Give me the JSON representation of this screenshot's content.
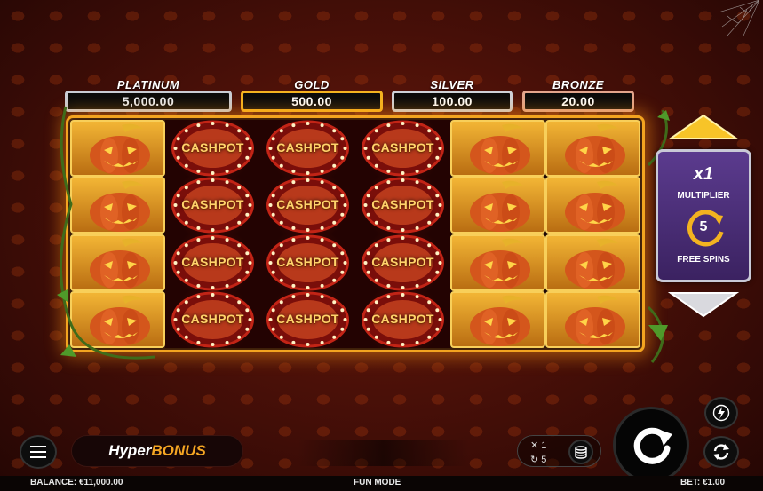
{
  "jackpots": [
    {
      "name": "PLATINUM",
      "value": "5,000.00",
      "color": "#c9ccd4"
    },
    {
      "name": "GOLD",
      "value": "500.00",
      "color": "#f4b320"
    },
    {
      "name": "SILVER",
      "value": "100.00",
      "color": "#cfd2d8"
    },
    {
      "name": "BRONZE",
      "value": "20.00",
      "color": "#e3a58c"
    }
  ],
  "reels": {
    "symbol_label": "CASHPOT",
    "columns": [
      [
        "pumpkin",
        "pumpkin",
        "pumpkin",
        "pumpkin"
      ],
      [
        "cashpot",
        "cashpot",
        "cashpot",
        "cashpot"
      ],
      [
        "cashpot",
        "cashpot",
        "cashpot",
        "cashpot"
      ],
      [
        "cashpot",
        "cashpot",
        "cashpot",
        "cashpot"
      ],
      [
        "pumpkin",
        "pumpkin",
        "pumpkin",
        "pumpkin"
      ],
      [
        "pumpkin",
        "pumpkin",
        "pumpkin",
        "pumpkin"
      ]
    ]
  },
  "side_panel": {
    "multiplier": "x1",
    "multiplier_label": "MULTIPLIER",
    "free_spins_count": "5",
    "free_spins_label": "FREE SPINS"
  },
  "bottom_bar": {
    "hyper_label": "Hyper",
    "bonus_label": "BONUS",
    "autoplay_multiplier": "1",
    "autoplay_spins": "5"
  },
  "status_bar": {
    "balance": "BALANCE: €11,000.00",
    "mode": "FUN MODE",
    "bet": "BET: €1.00"
  },
  "colors": {
    "accent": "#f3a420",
    "panel": "#4a2c78",
    "cash_text": "#ffd36b"
  },
  "icons": [
    "menu-icon",
    "lightning-icon",
    "autoplay-icon",
    "spin-icon",
    "coin-stack-icon",
    "refresh-icon",
    "arrow-up-icon",
    "arrow-down-icon",
    "pumpkin-icon",
    "spider-web-icon"
  ]
}
